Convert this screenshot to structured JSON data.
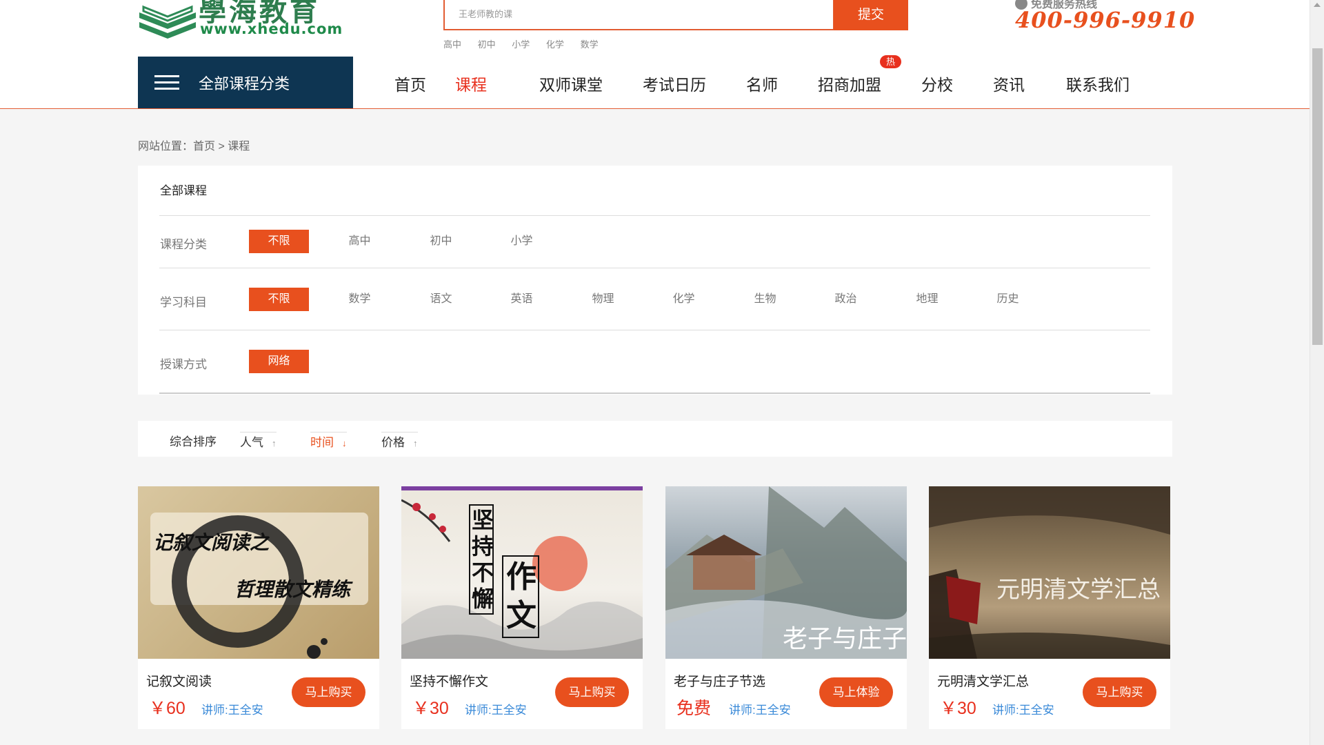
{
  "header": {
    "logo_cn": "學海教育",
    "logo_url": "www.xhedu.com",
    "search_placeholder": "王老师教的课",
    "search_button": "提交",
    "hot_words": [
      "高中",
      "初中",
      "小学",
      "化学",
      "数学"
    ],
    "hotline_label": "免费服务热线",
    "hotline_number": "400-996-9910"
  },
  "catbar": {
    "label": "全部课程分类"
  },
  "nav": {
    "items": [
      {
        "label": "首页"
      },
      {
        "label": "课程",
        "active": true
      },
      {
        "label": "双师课堂"
      },
      {
        "label": "考试日历"
      },
      {
        "label": "名师"
      },
      {
        "label": "招商加盟",
        "badge": "热"
      },
      {
        "label": "分校"
      },
      {
        "label": "资讯"
      },
      {
        "label": "联系我们"
      }
    ]
  },
  "breadcrumb": "网站位置：首页 > 课程",
  "filter": {
    "title": "全部课程",
    "rows": [
      {
        "label": "课程分类",
        "options": [
          "不限",
          "高中",
          "初中",
          "小学"
        ],
        "selected": "不限"
      },
      {
        "label": "学习科目",
        "options": [
          "不限",
          "数学",
          "语文",
          "英语",
          "物理",
          "化学",
          "生物",
          "政治",
          "地理",
          "历史"
        ],
        "selected": "不限"
      },
      {
        "label": "授课方式",
        "options": [
          "网络"
        ],
        "selected": "网络"
      }
    ]
  },
  "sort": {
    "label": "综合排序",
    "items": [
      {
        "label": "人气",
        "arrow": "↑"
      },
      {
        "label": "时间",
        "arrow": "↓",
        "active": true
      },
      {
        "label": "价格",
        "arrow": "↑"
      }
    ]
  },
  "courses": [
    {
      "title": "记叙文阅读",
      "price": "￥60",
      "teacher": "讲师:王全安",
      "button": "马上购买",
      "thumb_text": [
        "记叙文阅读之",
        "哲理散文精练"
      ]
    },
    {
      "title": "坚持不懈作文",
      "price": "￥30",
      "teacher": "讲师:王全安",
      "button": "马上购买",
      "thumb_text": [
        "坚持不懈",
        "作文"
      ]
    },
    {
      "title": "老子与庄子节选",
      "price": "免费",
      "teacher": "讲师:王全安",
      "button": "马上体验",
      "thumb_text": [
        "老子与庄子"
      ]
    },
    {
      "title": "元明清文学汇总",
      "price": "￥30",
      "teacher": "讲师:王全安",
      "button": "马上购买",
      "thumb_text": [
        "元明清文学汇总"
      ]
    }
  ],
  "colors": {
    "accent": "#e8501e",
    "nav_active": "#e8301e",
    "catbar_bg": "#0e3552",
    "teacher_link": "#3a8ad8"
  }
}
